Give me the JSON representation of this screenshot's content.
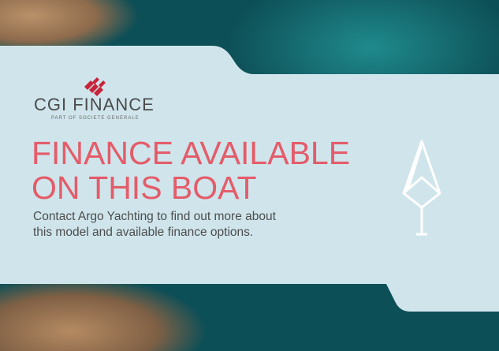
{
  "brand": {
    "name": "CGI FINANCE",
    "tagline": "PART OF SOCIETE GENERALE"
  },
  "headline": {
    "line1": "FINANCE AVAILABLE",
    "line2": "ON THIS BOAT"
  },
  "body_text": {
    "line1": "Contact Argo Yachting to find out more about",
    "line2": "this model and available finance options."
  },
  "colors": {
    "panel": "#cfe5eb",
    "headline": "#e45c6a",
    "logo_mark": "#c8243c",
    "text": "#4d4d4d",
    "monogram": "#ffffff"
  },
  "icons": {
    "logo_mark": "cgi-finance-logo-icon",
    "monogram": "argo-yachting-monogram-icon"
  }
}
